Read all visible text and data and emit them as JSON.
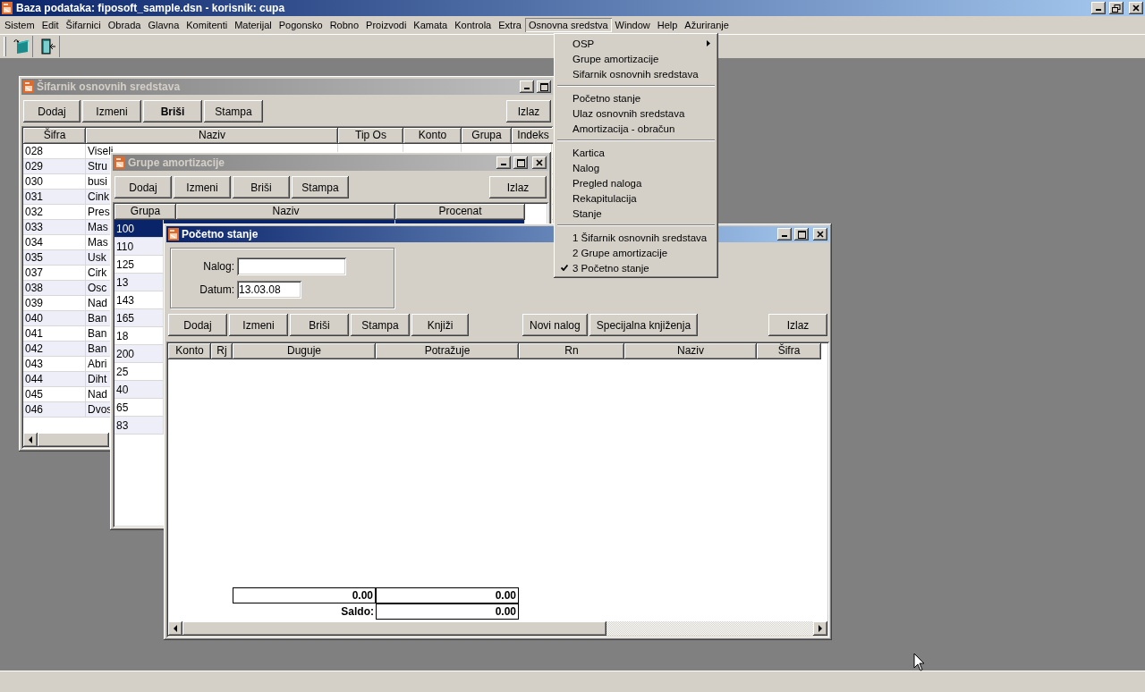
{
  "app_title": "Baza podataka: fiposoft_sample.dsn  -  korisnik: cupa",
  "menu_bar": [
    {
      "label": "Sistem",
      "selected": false
    },
    {
      "label": "Edit",
      "selected": false
    },
    {
      "label": "Šifarnici",
      "selected": false
    },
    {
      "label": "Obrada",
      "selected": false
    },
    {
      "label": "Glavna",
      "selected": false
    },
    {
      "label": "Komitenti",
      "selected": false
    },
    {
      "label": "Materijal",
      "selected": false
    },
    {
      "label": "Pogonsko",
      "selected": false
    },
    {
      "label": "Robno",
      "selected": false
    },
    {
      "label": "Proizvodi",
      "selected": false
    },
    {
      "label": "Kamata",
      "selected": false
    },
    {
      "label": "Kontrola",
      "selected": false
    },
    {
      "label": "Extra",
      "selected": false
    },
    {
      "label": "Osnovna sredstva",
      "selected": true
    },
    {
      "label": "Window",
      "selected": false
    },
    {
      "label": "Help",
      "selected": false
    },
    {
      "label": "Ažuriranje",
      "selected": false
    }
  ],
  "dropdown": [
    {
      "kind": "submenu",
      "label": "OSP",
      "checked": false
    },
    {
      "kind": "item",
      "label": "Grupe amortizacije",
      "checked": false
    },
    {
      "kind": "item",
      "label": "Sifarnik osnovnih sredstava",
      "checked": false
    },
    {
      "kind": "separator"
    },
    {
      "kind": "item",
      "label": "Početno stanje",
      "checked": false
    },
    {
      "kind": "item",
      "label": "Ulaz osnovnih sredstava",
      "checked": false
    },
    {
      "kind": "item",
      "label": "Amortizacija - obračun",
      "checked": false
    },
    {
      "kind": "separator"
    },
    {
      "kind": "item",
      "label": "Kartica",
      "checked": false
    },
    {
      "kind": "item",
      "label": "Nalog",
      "checked": false
    },
    {
      "kind": "item",
      "label": "Pregled naloga",
      "checked": false
    },
    {
      "kind": "item",
      "label": "Rekapitulacija",
      "checked": false
    },
    {
      "kind": "item",
      "label": "Stanje",
      "checked": false
    },
    {
      "kind": "separator"
    },
    {
      "kind": "item",
      "label": "1 Šifarnik osnovnih sredstava",
      "checked": false
    },
    {
      "kind": "item",
      "label": "2 Grupe amortizacije",
      "checked": false
    },
    {
      "kind": "item",
      "label": "3 Početno stanje",
      "checked": true
    }
  ],
  "sifarnik_window": {
    "title": "Šifarnik osnovnih sredstava",
    "active": false,
    "buttons": [
      {
        "label": "Dodaj",
        "default": false
      },
      {
        "label": "Izmeni",
        "default": false
      },
      {
        "label": "Briši",
        "default": true
      },
      {
        "label": "Stampa",
        "default": false
      }
    ],
    "exit_button": "Izlaz",
    "columns": [
      "Šifra",
      "Naziv",
      "Tip Os",
      "Konto",
      "Grupa",
      "Indeks"
    ],
    "rows": [
      [
        "028",
        "Viseli"
      ],
      [
        "029",
        "Stru"
      ],
      [
        "030",
        "busi"
      ],
      [
        "031",
        "Cink"
      ],
      [
        "032",
        "Pres"
      ],
      [
        "033",
        "Mas"
      ],
      [
        "034",
        "Mas"
      ],
      [
        "035",
        "Usk"
      ],
      [
        "037",
        "Cirk"
      ],
      [
        "038",
        "Osc"
      ],
      [
        "039",
        "Nad"
      ],
      [
        "040",
        "Ban"
      ],
      [
        "041",
        "Ban"
      ],
      [
        "042",
        "Ban"
      ],
      [
        "043",
        "Abri"
      ],
      [
        "044",
        "Diht"
      ],
      [
        "045",
        "Nad"
      ],
      [
        "046",
        "Dvos"
      ]
    ]
  },
  "grupe_window": {
    "title": "Grupe amortizacije",
    "active": false,
    "buttons": [
      {
        "label": "Dodaj",
        "default": false
      },
      {
        "label": "Izmeni",
        "default": false
      },
      {
        "label": "Briši",
        "default": false
      },
      {
        "label": "Stampa",
        "default": false
      }
    ],
    "exit_button": "Izlaz",
    "columns": [
      "Grupa",
      "Naziv",
      "Procenat"
    ],
    "rows": [
      {
        "grupa": "100",
        "selected": true
      },
      {
        "grupa": "110",
        "selected": false
      },
      {
        "grupa": "125",
        "selected": false
      },
      {
        "grupa": "13",
        "selected": false
      },
      {
        "grupa": "143",
        "selected": false
      },
      {
        "grupa": "165",
        "selected": false
      },
      {
        "grupa": "18",
        "selected": false
      },
      {
        "grupa": "200",
        "selected": false
      },
      {
        "grupa": "25",
        "selected": false
      },
      {
        "grupa": "40",
        "selected": false
      },
      {
        "grupa": "65",
        "selected": false
      },
      {
        "grupa": "83",
        "selected": false
      }
    ]
  },
  "pocetno_window": {
    "title": "Početno stanje",
    "active": true,
    "nalog_label": "Nalog:",
    "datum_label": "Datum:",
    "datum_value": "13.03.08",
    "buttons": [
      {
        "label": "Dodaj",
        "default": false
      },
      {
        "label": "Izmeni",
        "default": false
      },
      {
        "label": "Briši",
        "default": false
      },
      {
        "label": "Stampa",
        "default": false
      },
      {
        "label": "Knjiži",
        "default": false
      }
    ],
    "extra_buttons": [
      "Novi nalog",
      "Specijalna knjiženja"
    ],
    "exit_button": "Izlaz",
    "columns": [
      "Konto",
      "Rj",
      "Duguje",
      "Potražuje",
      "Rn",
      "Naziv",
      "Šifra"
    ],
    "total_duguje": "0.00",
    "total_potrazuje": "0.00",
    "saldo_label": "Saldo:",
    "saldo_value": "0.00"
  }
}
